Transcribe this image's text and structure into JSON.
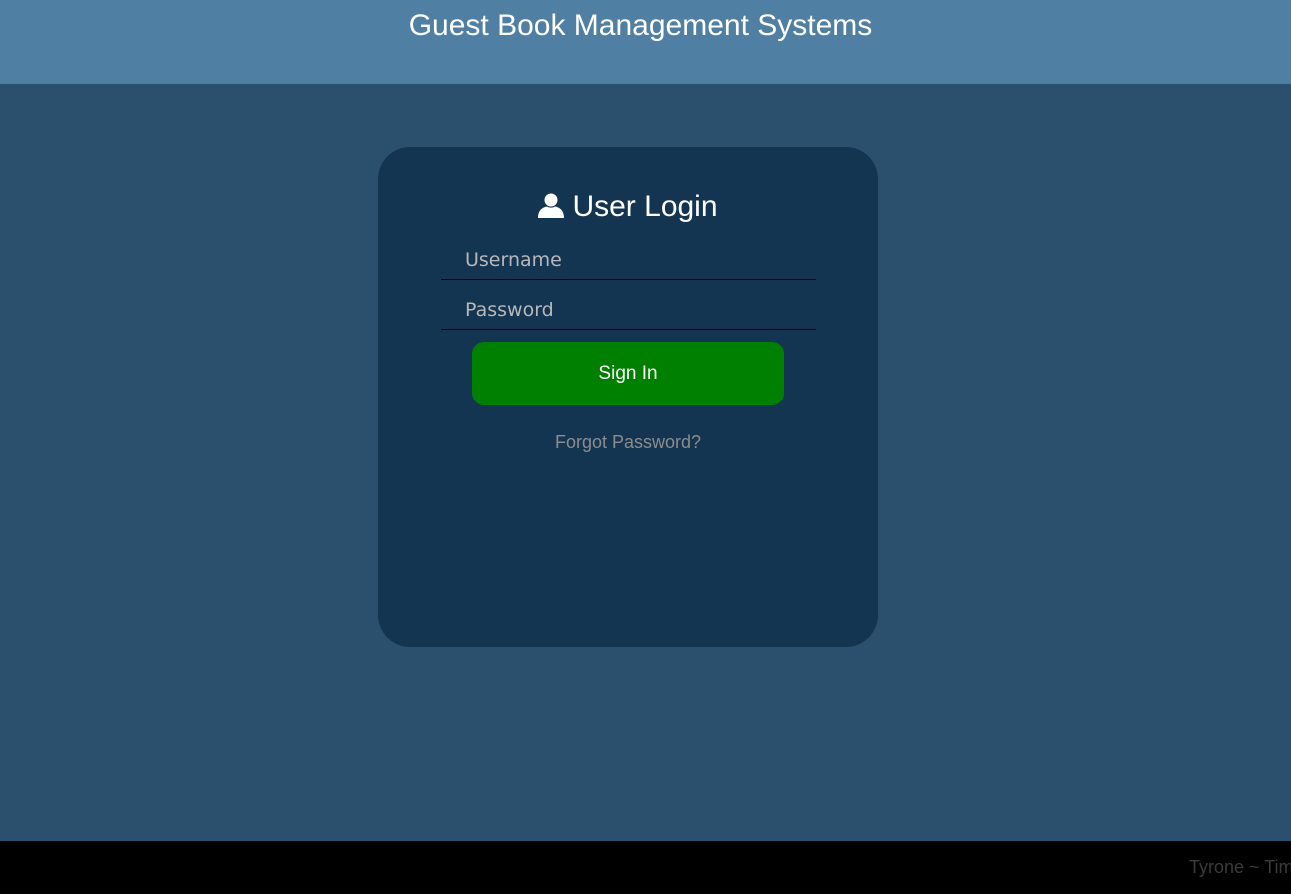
{
  "header": {
    "title": "Guest Book Management Systems"
  },
  "login": {
    "heading": "User Login",
    "heading_icon": "user-icon",
    "username_placeholder": "Username",
    "username_value": "",
    "password_placeholder": "Password",
    "password_value": "",
    "signin_label": "Sign In",
    "forgot_label": "Forgot Password?"
  },
  "footer": {
    "text": "Tyrone ~ Tim"
  },
  "colors": {
    "header_bg": "#507fa4",
    "page_bg": "#2b506e",
    "card_bg": "#133552",
    "signin_bg": "#008000",
    "footer_bg": "#000000"
  }
}
